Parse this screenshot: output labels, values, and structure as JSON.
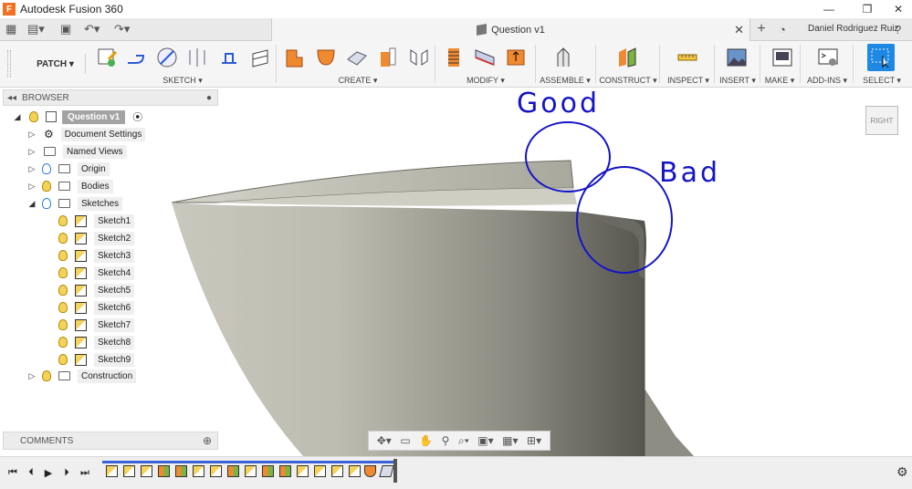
{
  "window": {
    "title": "Autodesk Fusion 360",
    "logo_letter": "F",
    "minimize_icon": "minimize-icon",
    "maximize_icon": "maximize-icon",
    "close_icon": "close-icon"
  },
  "document": {
    "tab_title": "Question v1",
    "close_label": "✕",
    "user_name": "Daniel Rodriguez Ruiz"
  },
  "toolbar": {
    "workspace": "PATCH ▾",
    "groups": {
      "sketch": "SKETCH ▾",
      "create": "CREATE ▾",
      "modify": "MODIFY ▾",
      "assemble": "ASSEMBLE ▾",
      "construct": "CONSTRUCT ▾",
      "inspect": "INSPECT ▾",
      "insert": "INSERT ▾",
      "make": "MAKE ▾",
      "addins": "ADD-INS ▾",
      "select": "SELECT ▾"
    }
  },
  "browser": {
    "title": "BROWSER",
    "root": "Question v1",
    "items": [
      {
        "label": "Document Settings"
      },
      {
        "label": "Named Views"
      },
      {
        "label": "Origin"
      },
      {
        "label": "Bodies"
      },
      {
        "label": "Sketches"
      },
      {
        "label": "Sketch1"
      },
      {
        "label": "Sketch2"
      },
      {
        "label": "Sketch3"
      },
      {
        "label": "Sketch4"
      },
      {
        "label": "Sketch5"
      },
      {
        "label": "Sketch6"
      },
      {
        "label": "Sketch7"
      },
      {
        "label": "Sketch8"
      },
      {
        "label": "Sketch9"
      },
      {
        "label": "Construction"
      }
    ]
  },
  "comments": {
    "title": "COMMENTS"
  },
  "viewcube": {
    "face": "RIGHT"
  },
  "annotations": {
    "good": "Good",
    "bad": "Bad"
  },
  "colors": {
    "annotation": "#1414c8",
    "select_active": "#1e88e5",
    "timeline_track": "#3b63d8"
  }
}
